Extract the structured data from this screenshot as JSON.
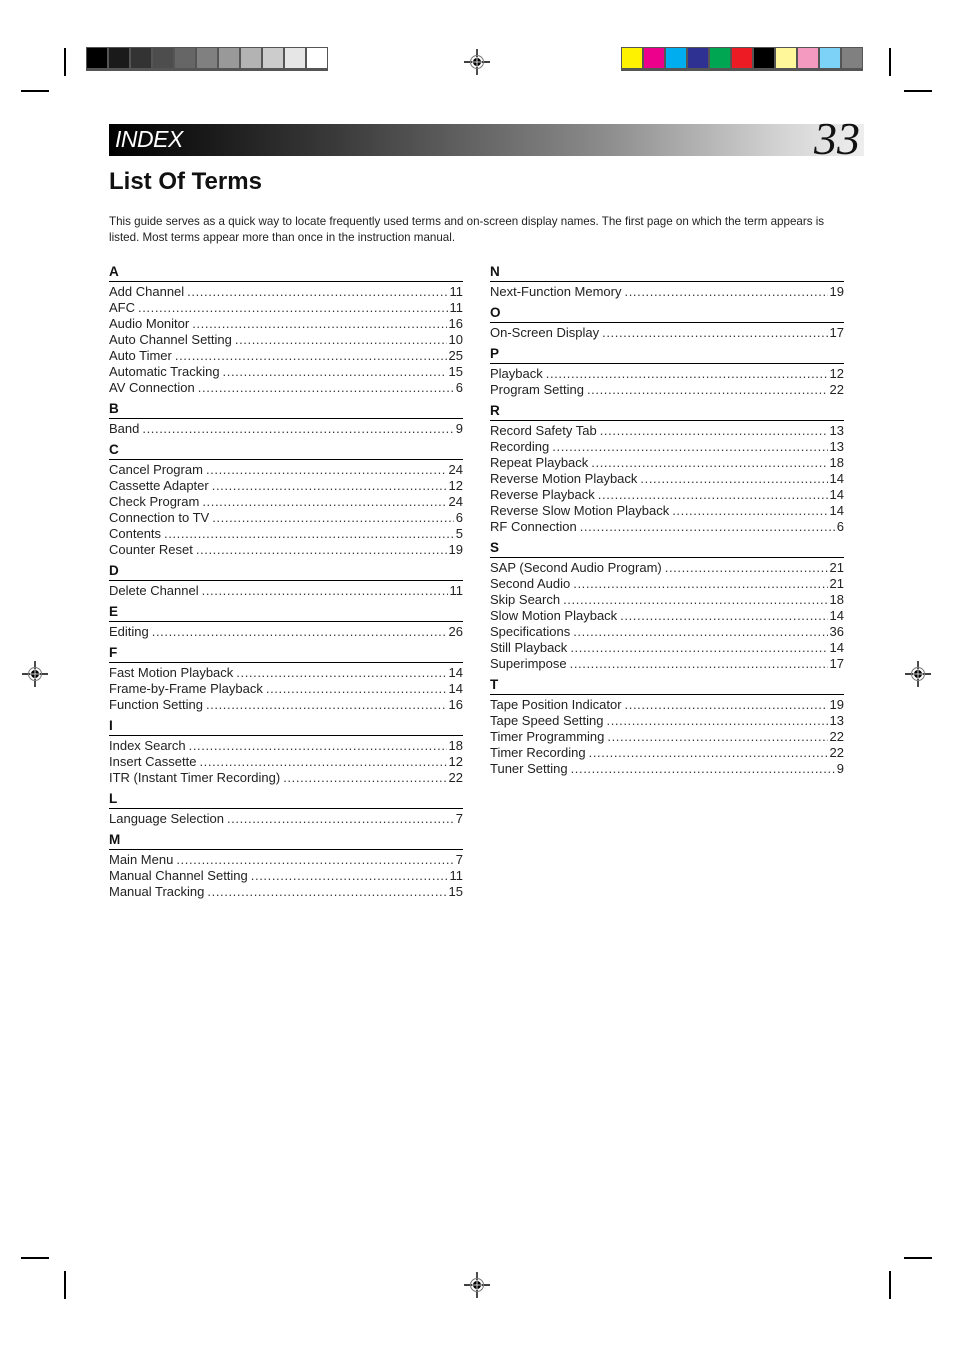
{
  "header": {
    "section_title": "INDEX",
    "page_number": "33"
  },
  "page_title": "List Of Terms",
  "intro_text": "This guide serves as a quick way to locate frequently used terms and on-screen display names. The first page on which the term appears is listed. Most terms appear more than once in the instruction manual.",
  "print_marks": {
    "grayscale_bar": [
      "#000000",
      "#1a1a1a",
      "#333333",
      "#4d4d4d",
      "#666666",
      "#808080",
      "#999999",
      "#b3b3b3",
      "#cccccc",
      "#e6e6e6",
      "#ffffff"
    ],
    "color_bar": [
      "#fff200",
      "#ec008c",
      "#00aeef",
      "#2e3192",
      "#00a651",
      "#ed1c24",
      "#000000",
      "#fff799",
      "#f49ac1",
      "#7dd3f7",
      "#808080"
    ]
  },
  "index": {
    "left_column": [
      {
        "letter": "A",
        "entries": [
          {
            "term": "Add Channel",
            "page": "11"
          },
          {
            "term": "AFC",
            "page": "11"
          },
          {
            "term": "Audio Monitor",
            "page": "16"
          },
          {
            "term": "Auto Channel Setting",
            "page": "10"
          },
          {
            "term": "Auto Timer",
            "page": "25"
          },
          {
            "term": "Automatic Tracking",
            "page": "15"
          },
          {
            "term": "AV Connection",
            "page": "6"
          }
        ]
      },
      {
        "letter": "B",
        "entries": [
          {
            "term": "Band",
            "page": "9"
          }
        ]
      },
      {
        "letter": "C",
        "entries": [
          {
            "term": "Cancel Program",
            "page": "24"
          },
          {
            "term": "Cassette Adapter",
            "page": "12"
          },
          {
            "term": "Check Program",
            "page": "24"
          },
          {
            "term": "Connection to TV",
            "page": "6"
          },
          {
            "term": "Contents",
            "page": "5"
          },
          {
            "term": "Counter Reset",
            "page": "19"
          }
        ]
      },
      {
        "letter": "D",
        "entries": [
          {
            "term": "Delete Channel",
            "page": "11"
          }
        ]
      },
      {
        "letter": "E",
        "entries": [
          {
            "term": "Editing",
            "page": "26"
          }
        ]
      },
      {
        "letter": "F",
        "entries": [
          {
            "term": "Fast Motion Playback",
            "page": "14"
          },
          {
            "term": "Frame-by-Frame Playback",
            "page": "14"
          },
          {
            "term": "Function Setting",
            "page": "16"
          }
        ]
      },
      {
        "letter": "I",
        "entries": [
          {
            "term": "Index Search",
            "page": "18"
          },
          {
            "term": "Insert Cassette",
            "page": "12"
          },
          {
            "term": "ITR (Instant Timer Recording)",
            "page": "22"
          }
        ]
      },
      {
        "letter": "L",
        "entries": [
          {
            "term": "Language Selection",
            "page": "7"
          }
        ]
      },
      {
        "letter": "M",
        "entries": [
          {
            "term": "Main Menu",
            "page": "7"
          },
          {
            "term": "Manual Channel Setting",
            "page": "11"
          },
          {
            "term": "Manual Tracking",
            "page": "15"
          }
        ]
      }
    ],
    "right_column": [
      {
        "letter": "N",
        "entries": [
          {
            "term": "Next-Function Memory",
            "page": "19"
          }
        ]
      },
      {
        "letter": "O",
        "entries": [
          {
            "term": "On-Screen Display",
            "page": "17"
          }
        ]
      },
      {
        "letter": "P",
        "entries": [
          {
            "term": "Playback",
            "page": "12"
          },
          {
            "term": "Program Setting",
            "page": "22"
          }
        ]
      },
      {
        "letter": "R",
        "entries": [
          {
            "term": "Record Safety Tab",
            "page": "13"
          },
          {
            "term": "Recording",
            "page": "13"
          },
          {
            "term": "Repeat Playback",
            "page": "18"
          },
          {
            "term": "Reverse Motion Playback",
            "page": "14"
          },
          {
            "term": "Reverse Playback",
            "page": "14"
          },
          {
            "term": "Reverse Slow Motion Playback",
            "page": "14"
          },
          {
            "term": "RF Connection",
            "page": "6"
          }
        ]
      },
      {
        "letter": "S",
        "entries": [
          {
            "term": "SAP (Second Audio Program)",
            "page": "21"
          },
          {
            "term": "Second Audio",
            "page": "21"
          },
          {
            "term": "Skip Search",
            "page": "18"
          },
          {
            "term": "Slow Motion Playback",
            "page": "14"
          },
          {
            "term": "Specifications",
            "page": "36"
          },
          {
            "term": "Still Playback",
            "page": "14"
          },
          {
            "term": "Superimpose",
            "page": "17"
          }
        ]
      },
      {
        "letter": "T",
        "entries": [
          {
            "term": "Tape Position Indicator",
            "page": "19"
          },
          {
            "term": "Tape Speed Setting",
            "page": "13"
          },
          {
            "term": "Timer Programming",
            "page": "22"
          },
          {
            "term": "Timer Recording",
            "page": "22"
          },
          {
            "term": "Tuner Setting",
            "page": "9"
          }
        ]
      }
    ]
  }
}
